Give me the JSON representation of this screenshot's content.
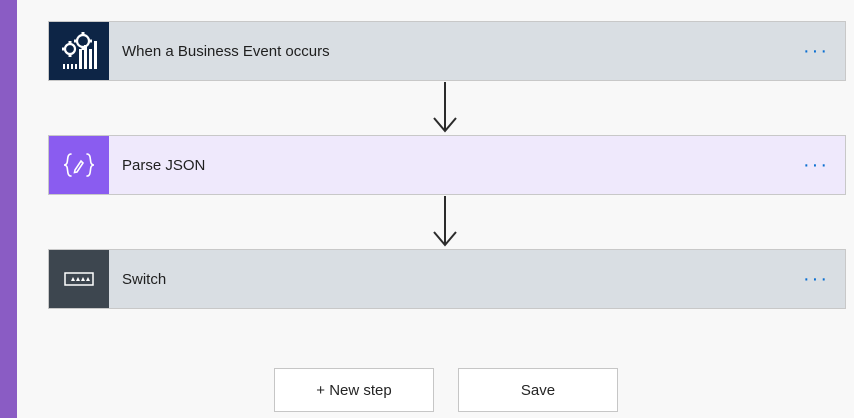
{
  "steps": [
    {
      "label": "When a Business Event occurs",
      "icon": "business-event-gears-icon",
      "more": "···"
    },
    {
      "label": "Parse JSON",
      "icon": "curly-braces-icon",
      "more": "···"
    },
    {
      "label": "Switch",
      "icon": "switch-icon",
      "more": "···"
    }
  ],
  "buttons": {
    "new_step": "+ New step",
    "save": "Save"
  },
  "colors": {
    "frame": "#8a5cc4",
    "trigger_icon_bg": "#0d2546",
    "parse_icon_bg": "#8a5cf0",
    "switch_icon_bg": "#3d464f",
    "more_dots": "#0a6ed1"
  }
}
